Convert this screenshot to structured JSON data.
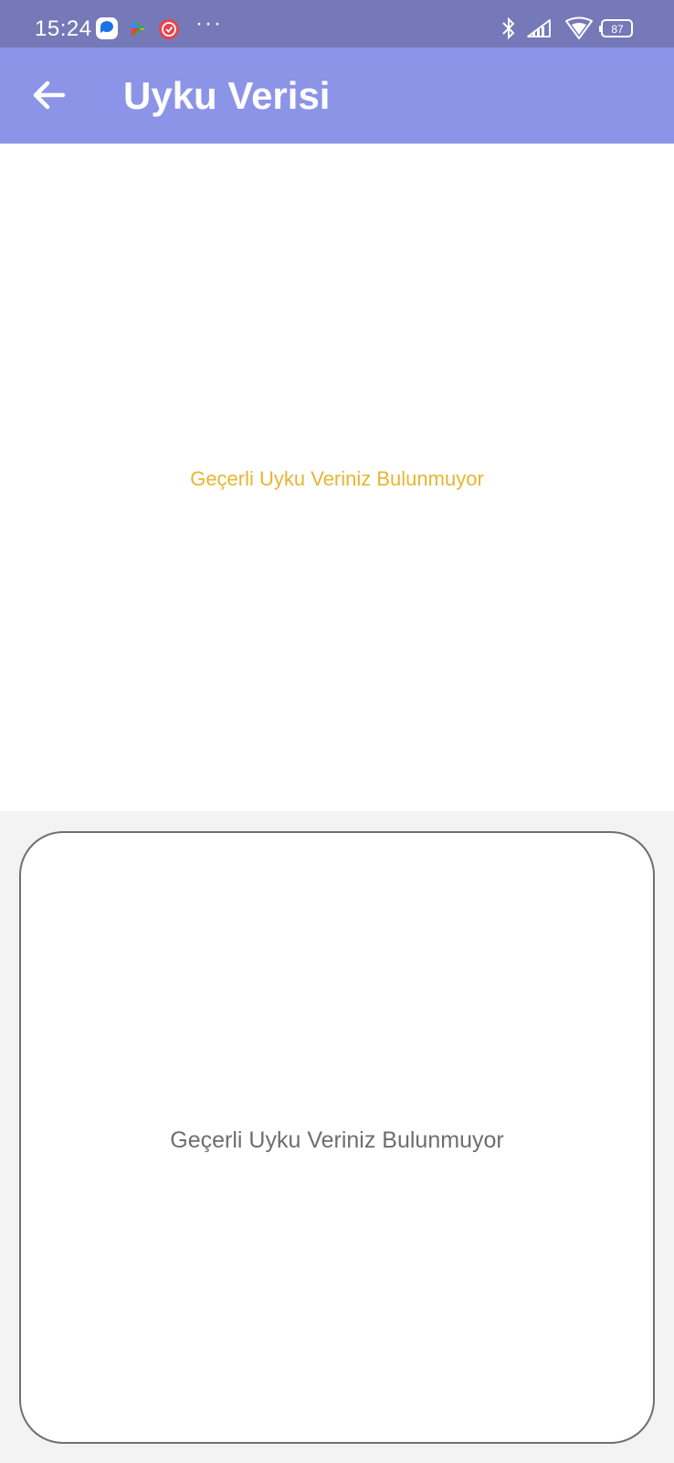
{
  "status_bar": {
    "time": "15:24",
    "battery": "87",
    "more_indicator": "···",
    "left_icons": [
      "messages-icon",
      "play-games-icon",
      "clock-app-icon"
    ],
    "right_icons": [
      "bluetooth-icon",
      "signal-icon",
      "wifi-icon",
      "battery-icon"
    ]
  },
  "app_bar": {
    "title": "Uyku Verisi",
    "back_icon": "arrow-left-icon",
    "background": "#8c94e8"
  },
  "top_panel": {
    "empty_message": "Geçerli Uyku Veriniz Bulunmuyor",
    "message_color": "#e6b534"
  },
  "card": {
    "empty_message": "Geçerli Uyku Veriniz Bulunmuyor"
  },
  "colors": {
    "status_bar": "#7579b8",
    "page_background": "#f3f3f3"
  }
}
